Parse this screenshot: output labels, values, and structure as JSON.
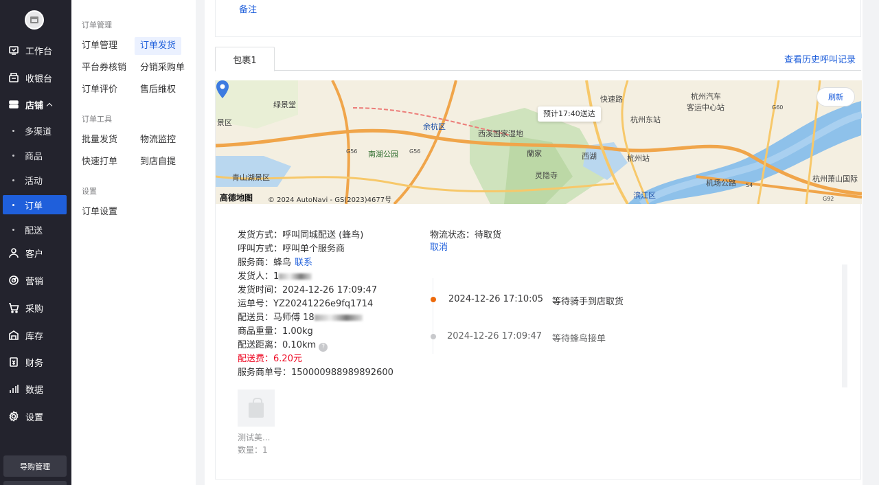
{
  "sidebar": {
    "guide_button": "导购管理",
    "items": [
      {
        "label": "工作台",
        "icon": "workbench-icon"
      },
      {
        "label": "收银台",
        "icon": "cashier-icon"
      },
      {
        "label": "店铺",
        "icon": "store-icon"
      },
      {
        "label": "客户",
        "icon": "customer-icon"
      },
      {
        "label": "营销",
        "icon": "marketing-icon"
      },
      {
        "label": "采购",
        "icon": "cart-icon"
      },
      {
        "label": "库存",
        "icon": "inventory-icon"
      },
      {
        "label": "财务",
        "icon": "finance-icon"
      },
      {
        "label": "数据",
        "icon": "chart-icon"
      },
      {
        "label": "设置",
        "icon": "gear-icon"
      }
    ],
    "store_children": [
      "多渠道",
      "商品",
      "活动",
      "订单",
      "配送"
    ],
    "active_child": "订单"
  },
  "submenu": {
    "groups": [
      {
        "title": "订单管理",
        "links": [
          "订单管理",
          "订单发货",
          "平台券核销",
          "分销采购单",
          "订单评价",
          "售后维权"
        ]
      },
      {
        "title": "订单工具",
        "links": [
          "批量发货",
          "物流监控",
          "快速打单",
          "到店自提"
        ]
      },
      {
        "title": "设置",
        "links": [
          "订单设置"
        ]
      }
    ],
    "active_link": "订单发货"
  },
  "top": {
    "note_link": "备注"
  },
  "tabs": {
    "package_tab": "包裹1",
    "history_link": "查看历史呼叫记录"
  },
  "map": {
    "eta": "预计17:40送达",
    "refresh": "刷新",
    "logo": "高德地图",
    "copyright": "© 2024 AutoNavi - GS(2023)4677号",
    "labels": {
      "l1": "绿景堂",
      "l2": "景区",
      "l3": "余杭区",
      "l4": "西溪国家湿地",
      "l5": "南湖公园",
      "l6": "青山湖景区",
      "l7": "灵隐寺",
      "l8": "西湖",
      "l9": "杭州东站",
      "l10": "杭州汽车",
      "l11": "客运中心站",
      "l12": "杭州站",
      "l13": "机场公路",
      "l14": "杭州萧山国际",
      "l15": "滨江区",
      "l16": "快速路",
      "l17": "G56",
      "l18": "G56",
      "l19": "G60",
      "l20": "S4",
      "l21": "G92",
      "l22": "蘭家"
    }
  },
  "shipment": {
    "method_label": "发货方式：",
    "method": "呼叫同城配送 (蜂鸟)",
    "call_label": "呼叫方式：",
    "call": "呼叫单个服务商",
    "provider_label": "服务商：",
    "provider": "蜂鸟",
    "contact": "联系",
    "sender_label": "发货人：",
    "sender": "1",
    "time_label": "发货时间：",
    "time": "2024-12-26 17:09:47",
    "waybill_label": "运单号：",
    "waybill": "YZ20241226e9fq1714",
    "courier_label": "配送员：",
    "courier": "马师傅 18",
    "weight_label": "商品重量：",
    "weight": "1.00kg",
    "distance_label": "配送距离：",
    "distance": "0.10km",
    "fee_label": "配送费：",
    "fee": "6.20元",
    "provider_no_label": "服务商单号：",
    "provider_no": "150000988989892600"
  },
  "logistics": {
    "status_label": "物流状态：",
    "status": "待取货",
    "cancel": "取消",
    "events": [
      {
        "time": "2024-12-26 17:10:05",
        "text": "等待骑手到店取货",
        "color": "#ed6a0c"
      },
      {
        "time": "2024-12-26 17:09:47",
        "text": "等待蜂鸟接单",
        "color": "#c8c9cc"
      }
    ]
  },
  "goods": {
    "name": "测试美...",
    "qty": "数量：1"
  },
  "colors": {
    "accent": "#1f5fdb",
    "sidebar_bg": "#23232d",
    "fee_red": "#ee0a24"
  }
}
